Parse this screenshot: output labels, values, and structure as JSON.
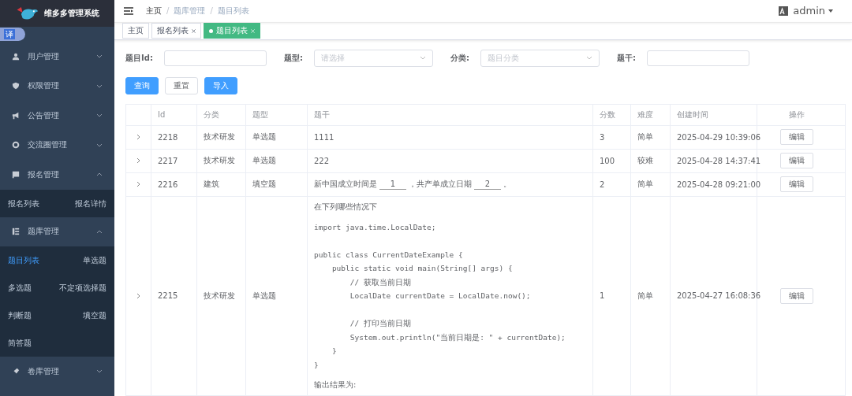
{
  "brand": {
    "title": "维多多管理系统"
  },
  "translate_badge": "译",
  "sidebar": {
    "items": [
      {
        "label": "用户管理",
        "expanded": false
      },
      {
        "label": "权限管理",
        "expanded": false
      },
      {
        "label": "公告管理",
        "expanded": false
      },
      {
        "label": "交流圈管理",
        "expanded": false
      },
      {
        "label": "报名管理",
        "expanded": true,
        "children": [
          {
            "label": "报名列表",
            "selected": false
          },
          {
            "label": "报名详情",
            "selected": false
          }
        ]
      },
      {
        "label": "题库管理",
        "expanded": true,
        "children": [
          {
            "label": "题目列表",
            "selected": true
          },
          {
            "label": "单选题",
            "selected": false
          },
          {
            "label": "多选题",
            "selected": false
          },
          {
            "label": "不定项选择题",
            "selected": false
          },
          {
            "label": "判断题",
            "selected": false
          },
          {
            "label": "填空题",
            "selected": false
          },
          {
            "label": "简答题",
            "selected": false
          }
        ]
      },
      {
        "label": "卷库管理",
        "expanded": false
      }
    ]
  },
  "breadcrumb": [
    {
      "label": "主页"
    },
    {
      "separator": "/",
      "label": "题库管理"
    },
    {
      "separator": "/",
      "label": "题目列表"
    }
  ],
  "user": {
    "name": "admin"
  },
  "tags": [
    {
      "label": "主页",
      "selected": false,
      "closable": false
    },
    {
      "label": "报名列表",
      "selected": false,
      "closable": true
    },
    {
      "label": "题目列表",
      "selected": true,
      "closable": true
    }
  ],
  "filters": [
    {
      "label": "题目Id:",
      "kind": "input"
    },
    {
      "label": "题型:",
      "kind": "select",
      "placeholder": "请选择"
    },
    {
      "label": "分类:",
      "kind": "select",
      "placeholder": "题目分类"
    },
    {
      "label": "题干:",
      "kind": "input"
    }
  ],
  "buttons": [
    {
      "label": "查询",
      "kind": "primary"
    },
    {
      "label": "重置",
      "kind": "plain"
    },
    {
      "label": "导入",
      "kind": "primary"
    }
  ],
  "table": {
    "columns": [
      "Id",
      "分类",
      "题型",
      "题干",
      "分数",
      "难度",
      "创建时间",
      "操作"
    ],
    "rows": [
      {
        "id": "2218",
        "category": "技术研发",
        "type": "单选题",
        "stem": [
          {
            "kind": "text",
            "text": "1111"
          }
        ],
        "score": "3",
        "difficulty": "简单",
        "created": "2025-04-29 10:39:06",
        "action": "编辑"
      },
      {
        "id": "2217",
        "category": "技术研发",
        "type": "单选题",
        "stem": [
          {
            "kind": "text",
            "text": "222"
          }
        ],
        "score": "100",
        "difficulty": "较难",
        "created": "2025-04-28 14:37:41",
        "action": "编辑"
      },
      {
        "id": "2216",
        "category": "建筑",
        "type": "填空题",
        "stem": [
          {
            "kind": "text",
            "text": "新中国成立时间是"
          },
          {
            "kind": "blank",
            "text": "1"
          },
          {
            "kind": "text",
            "text": "，共产单成立日期"
          },
          {
            "kind": "blank",
            "text": "2"
          },
          {
            "kind": "text",
            "text": "。"
          }
        ],
        "score": "2",
        "difficulty": "简单",
        "created": "2025-04-28 09:21:00",
        "action": "编辑"
      },
      {
        "id": "2215",
        "category": "技术研发",
        "type": "单选题",
        "stem": [
          {
            "kind": "para",
            "text": "在下列哪些情况下"
          },
          {
            "kind": "code",
            "text": "import java.time.LocalDate;\n\npublic class CurrentDateExample {\n    public static void main(String[] args) {\n        // 获取当前日期\n        LocalDate currentDate = LocalDate.now();\n\n        // 打印当前日期\n        System.out.println(\"当前日期是: \" + currentDate);\n    }\n}"
          },
          {
            "kind": "para",
            "text": "输出结果为:"
          }
        ],
        "score": "1",
        "difficulty": "简单",
        "created": "2025-04-27 16:08:36",
        "action": "编辑"
      }
    ]
  }
}
